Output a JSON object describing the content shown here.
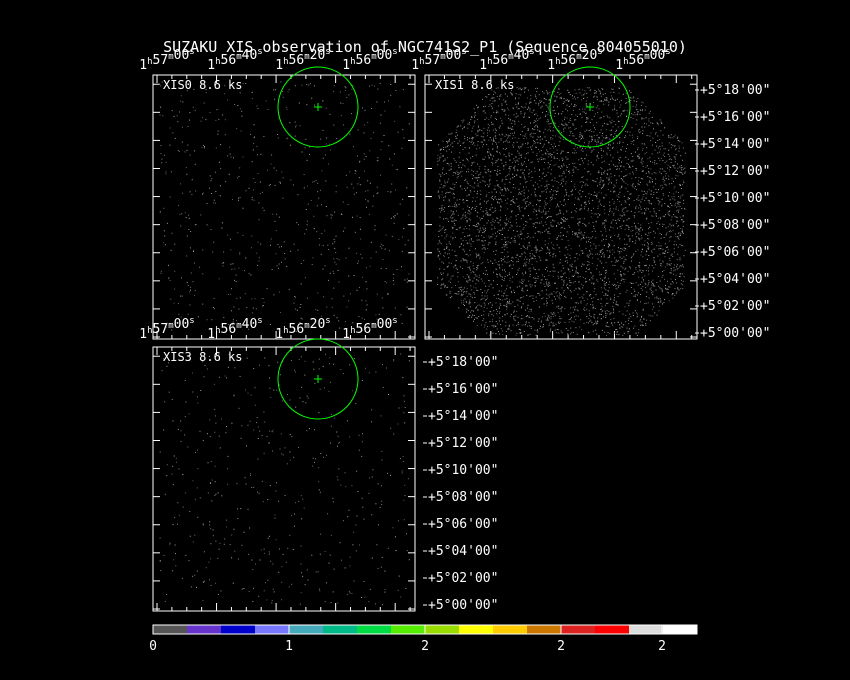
{
  "title": "SUZAKU XIS observation of NGC741S2_P1  (Sequence 804055010)",
  "ra_ticks_top": [
    "1h57m00s",
    "1h56m40s",
    "1h56m20s",
    "1h56m00s"
  ],
  "ra_ticks_mid": [
    "1h57m00s",
    "1h56m40s",
    "1h56m20s",
    "1h56m00s"
  ],
  "dec_ticks": [
    "+5°18'00\"",
    "+5°16'00\"",
    "+5°14'00\"",
    "+5°12'00\"",
    "+5°10'00\"",
    "+5°08'00\"",
    "+5°06'00\"",
    "+5°04'00\"",
    "+5°02'00\"",
    "+5°00'00\""
  ],
  "panels": [
    {
      "id": "xis0",
      "label": "XIS0  8.6 ks"
    },
    {
      "id": "xis1",
      "label": "XIS1  8.6 ks"
    },
    {
      "id": "xis3",
      "label": "XIS3  8.6 ks"
    }
  ],
  "colorbar": {
    "colors": [
      "#555555",
      "#6633cc",
      "#0000cc",
      "#7777ff",
      "#44aabb",
      "#00bb88",
      "#00dd44",
      "#55ee00",
      "#99dd00",
      "#ffff00",
      "#ffcc00",
      "#cc7700",
      "#dd2222",
      "#ff0000",
      "#dddddd",
      "#ffffff"
    ],
    "tick_labels": [
      "0",
      "1",
      "2",
      "2",
      "2"
    ]
  },
  "source_marker_color": "#00ff00"
}
